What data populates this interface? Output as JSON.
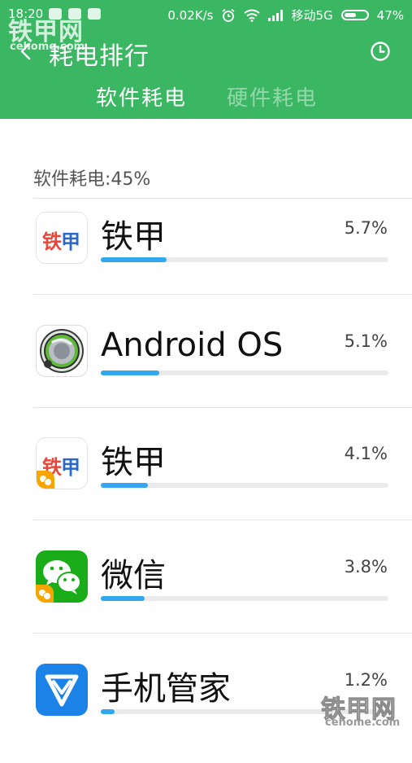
{
  "statusbar": {
    "time": "18:20",
    "net_speed": "0.02K/s",
    "carrier": "移动5G",
    "battery": "47%",
    "battery_level": 0.47
  },
  "header": {
    "title": "耗电排行",
    "tabs": [
      {
        "label": "软件耗电",
        "active": true
      },
      {
        "label": "硬件耗电",
        "active": false
      }
    ],
    "accent_color": "#3bb764"
  },
  "section": {
    "label": "软件耗电:45%"
  },
  "apps": [
    {
      "name": "铁甲",
      "percent_text": "5.7%",
      "percent": 5.7,
      "icon": "tiejia-icon"
    },
    {
      "name": "Android OS",
      "percent_text": "5.1%",
      "percent": 5.1,
      "icon": "android-os-icon"
    },
    {
      "name": "铁甲",
      "percent_text": "4.1%",
      "percent": 4.1,
      "icon": "tiejia-dual-icon"
    },
    {
      "name": "微信",
      "percent_text": "3.8%",
      "percent": 3.8,
      "icon": "wechat-dual-icon"
    },
    {
      "name": "手机管家",
      "percent_text": "1.2%",
      "percent": 1.2,
      "icon": "phone-manager-icon"
    }
  ],
  "icon_text": {
    "tiejia_part1": "铁",
    "tiejia_part2": "甲"
  },
  "watermark": {
    "brand": "铁甲网",
    "site": "cehome.com"
  },
  "bar_color": "#32a7f0",
  "bar_full_scale_percent": 100
}
